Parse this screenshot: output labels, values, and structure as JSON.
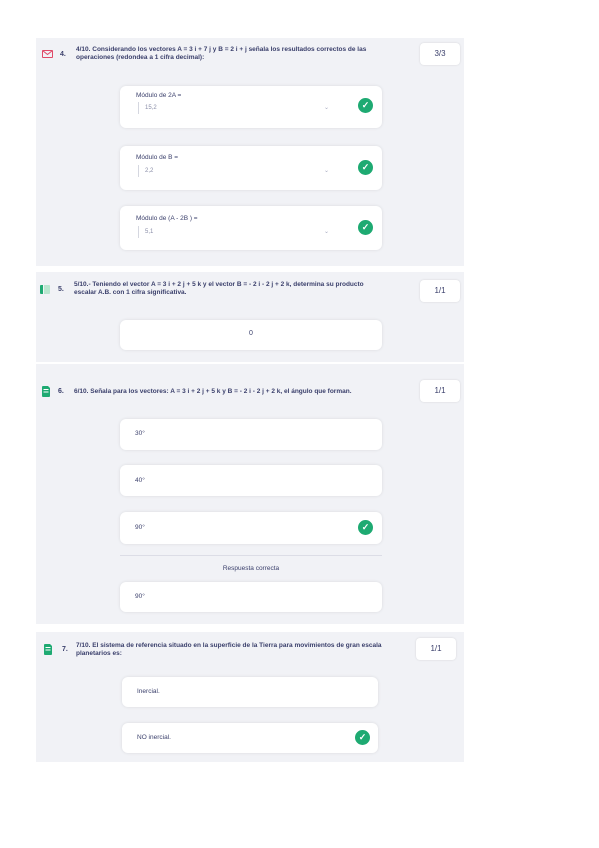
{
  "q4": {
    "number": "4.",
    "text_line1": "4/10. Considerando los vectores A = 3 i + 7 j  y  B = 2 i + j  señala los resultados correctos de las",
    "text_line2": "operaciones (redondea a 1 cifra decimal):",
    "score": "3/3",
    "items": [
      {
        "label": "Módulo de 2A =",
        "value": "15,2"
      },
      {
        "label": "Módulo de B =",
        "value": "2,2"
      },
      {
        "label": "Módulo de (A - 2B ) =",
        "value": "5,1"
      }
    ]
  },
  "q5": {
    "number": "5.",
    "text_line1": "5/10.- Teniendo el vector A = 3 i + 2 j + 5 k y el vector B = - 2 i - 2 j + 2 k, determina su producto",
    "text_line2": "escalar A.B. con 1 cifra significativa.",
    "score": "1/1",
    "answer": "0"
  },
  "q6": {
    "number": "6.",
    "text_line1": "6/10. Señala para los vectores: A = 3 i + 2 j + 5 k y  B = - 2 i - 2 j + 2 k, el ángulo que forman.",
    "score": "1/1",
    "options": [
      "30°",
      "40°",
      "90°"
    ],
    "correct_label": "Respuesta correcta",
    "correct_answer": "90°"
  },
  "q7": {
    "number": "7.",
    "text_line1": "7/10. El sistema de referencia situado en la superficie de la Tierra para movimientos de gran escala",
    "text_line2": "planetarios es:",
    "score": "1/1",
    "options": [
      "Inercial.",
      "NO inercial."
    ]
  },
  "colors": {
    "accent_green": "#1eaa72",
    "error_red": "#e04a68",
    "text": "#3a3f6b",
    "panel_bg": "#f1f2f6"
  }
}
